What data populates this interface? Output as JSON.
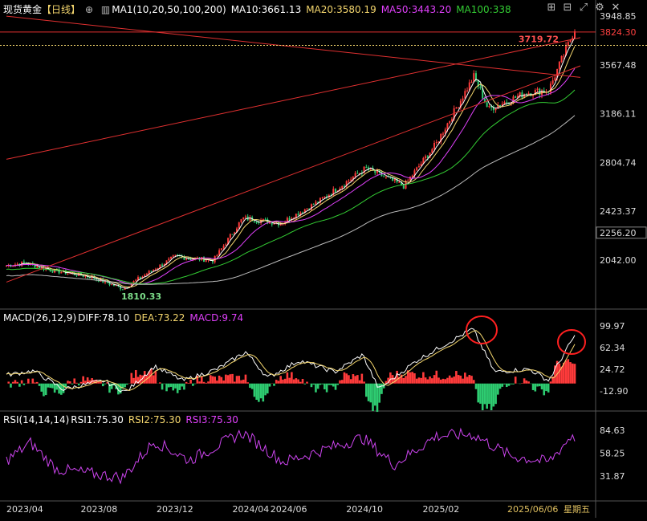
{
  "header": {
    "symbol": "现货黄金",
    "period": "【日线】",
    "ma_label": "MA1(10,20,50,100,200)",
    "ma10": "MA10:3661.13",
    "ma20": "MA20:3580.19",
    "ma50": "MA50:3443.20",
    "ma100": "MA100:338"
  },
  "toolbar_icons": [
    "plus-box-icon",
    "minus-box-icon",
    "expand-icon",
    "settings-icon",
    "close-icon"
  ],
  "macd_header": {
    "label": "MACD(26,12,9)",
    "diff": "DIFF:78.10",
    "dea": "DEA:73.22",
    "macd": "MACD:9.74"
  },
  "rsi_header": {
    "label": "RSI(14,14,14)",
    "rsi1": "RSI1:75.30",
    "rsi2": "RSI2:75.30",
    "rsi3": "RSI3:75.30"
  },
  "colors": {
    "up": "#ff3b3b",
    "down": "#2ecc71",
    "ma10": "#ffffff",
    "ma20": "#f5d76e",
    "ma50": "#e040fb",
    "ma100": "#33cc33",
    "ma200": "#bbbbbb",
    "trend": "#e03030",
    "rsi": "#cc44ee",
    "axis_text": "#dddddd",
    "date_text": "#e0c060"
  },
  "chart_data": [
    {
      "type": "candlestick",
      "name": "price",
      "y_ticks": [
        3948.85,
        3567.48,
        3186.11,
        2804.74,
        2423.37,
        2042.0
      ],
      "special_ticks": [
        {
          "value": 3824.3,
          "label": "3824.30",
          "color": "#ff4040"
        },
        {
          "value": 2256.2,
          "label": "2256.20",
          "color": "#dddddd",
          "boxed": true
        }
      ],
      "annotations": [
        {
          "label": "3719.72",
          "value": 3719.72
        },
        {
          "label": "1810.33",
          "value": 1810.33
        }
      ],
      "x_labels": [
        "2023/04",
        "2023/08",
        "2023/12",
        "2024/04",
        "2024/06",
        "2024/10",
        "2025/02",
        "2025/06/06",
        "星期五"
      ],
      "key_points": [
        {
          "date": "2023-04-01",
          "close": 2000
        },
        {
          "date": "2023-05-01",
          "close": 2020
        },
        {
          "date": "2023-06-15",
          "close": 1960
        },
        {
          "date": "2023-08-15",
          "close": 1910
        },
        {
          "date": "2023-10-05",
          "close": 1820
        },
        {
          "date": "2023-12-28",
          "close": 2070
        },
        {
          "date": "2024-02-28",
          "close": 2040
        },
        {
          "date": "2024-04-15",
          "close": 2370
        },
        {
          "date": "2024-06-15",
          "close": 2330
        },
        {
          "date": "2024-08-15",
          "close": 2500
        },
        {
          "date": "2024-10-30",
          "close": 2760
        },
        {
          "date": "2024-12-30",
          "close": 2620
        },
        {
          "date": "2025-02-20",
          "close": 2950
        },
        {
          "date": "2025-04-22",
          "close": 3480
        },
        {
          "date": "2025-05-15",
          "close": 3220
        },
        {
          "date": "2025-07-15",
          "close": 3350
        },
        {
          "date": "2025-08-20",
          "close": 3370
        },
        {
          "date": "2025-09-26",
          "close": 3790
        },
        {
          "date": "2025-10-01",
          "close": 3850
        }
      ]
    },
    {
      "type": "bar",
      "name": "macd",
      "y_ticks": [
        99.97,
        62.34,
        24.72,
        -12.9
      ],
      "key_points": [
        {
          "date": "2023-04-01",
          "diff": 15
        },
        {
          "date": "2023-05-15",
          "diff": 22
        },
        {
          "date": "2023-07-01",
          "diff": -10
        },
        {
          "date": "2023-09-05",
          "diff": 5
        },
        {
          "date": "2023-10-10",
          "diff": -15
        },
        {
          "date": "2023-11-25",
          "diff": 30
        },
        {
          "date": "2024-01-10",
          "diff": 5
        },
        {
          "date": "2024-03-05",
          "diff": 25
        },
        {
          "date": "2024-04-20",
          "diff": 55
        },
        {
          "date": "2024-05-25",
          "diff": 10
        },
        {
          "date": "2024-07-15",
          "diff": 40
        },
        {
          "date": "2024-09-10",
          "diff": 20
        },
        {
          "date": "2024-10-25",
          "diff": 50
        },
        {
          "date": "2024-11-20",
          "diff": -10
        },
        {
          "date": "2025-01-20",
          "diff": 40
        },
        {
          "date": "2025-04-20",
          "diff": 95
        },
        {
          "date": "2025-05-25",
          "diff": 20
        },
        {
          "date": "2025-07-20",
          "diff": 25
        },
        {
          "date": "2025-08-20",
          "diff": 5
        },
        {
          "date": "2025-09-28",
          "diff": 78
        },
        {
          "date": "2025-10-01",
          "diff": 82
        }
      ]
    },
    {
      "type": "line",
      "name": "rsi",
      "y_ticks": [
        84.63,
        58.25,
        31.87
      ],
      "key_points": [
        {
          "date": "2023-04-01",
          "rsi": 50
        },
        {
          "date": "2023-05-10",
          "rsi": 70
        },
        {
          "date": "2023-06-20",
          "rsi": 40
        },
        {
          "date": "2023-10-05",
          "rsi": 30
        },
        {
          "date": "2023-11-25",
          "rsi": 72
        },
        {
          "date": "2024-01-20",
          "rsi": 50
        },
        {
          "date": "2024-04-15",
          "rsi": 82
        },
        {
          "date": "2024-06-20",
          "rsi": 48
        },
        {
          "date": "2024-10-25",
          "rsi": 76
        },
        {
          "date": "2024-12-15",
          "rsi": 45
        },
        {
          "date": "2025-02-20",
          "rsi": 78
        },
        {
          "date": "2025-04-20",
          "rsi": 80
        },
        {
          "date": "2025-06-20",
          "rsi": 55
        },
        {
          "date": "2025-08-20",
          "rsi": 48
        },
        {
          "date": "2025-09-28",
          "rsi": 80
        },
        {
          "date": "2025-10-01",
          "rsi": 75
        }
      ]
    }
  ]
}
